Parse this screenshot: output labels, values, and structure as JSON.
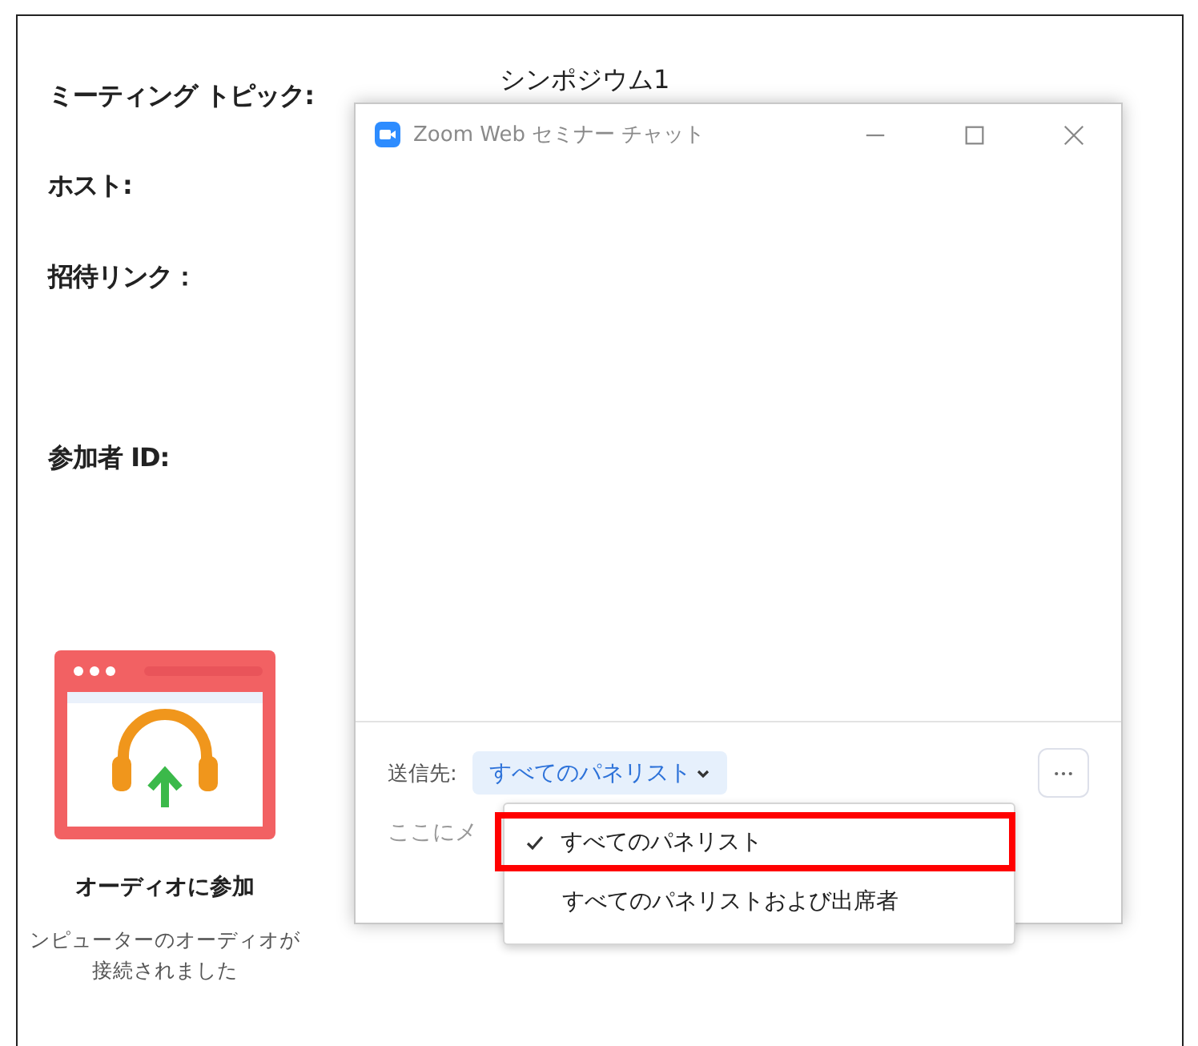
{
  "meeting_info": {
    "fields": [
      {
        "label": "ミーティング トピック:",
        "value": "シンポジウム1"
      },
      {
        "label": "ホスト:"
      },
      {
        "label": "招待リンク："
      },
      {
        "label": "参加者 ID:"
      }
    ]
  },
  "audio": {
    "label": "オーディオに参加",
    "status_lines": [
      "ンピューターのオーディオが",
      "接続されました"
    ]
  },
  "chat_window": {
    "title": "Zoom Web セミナー チャット",
    "send_to_label": "送信先:",
    "recipient": "すべてのパネリスト",
    "placeholder": "ここにメ",
    "menu": [
      {
        "label": "すべてのパネリスト",
        "selected": true,
        "highlighted": true
      },
      {
        "label": "すべてのパネリストおよび出席者",
        "selected": false,
        "highlighted": false
      }
    ]
  }
}
